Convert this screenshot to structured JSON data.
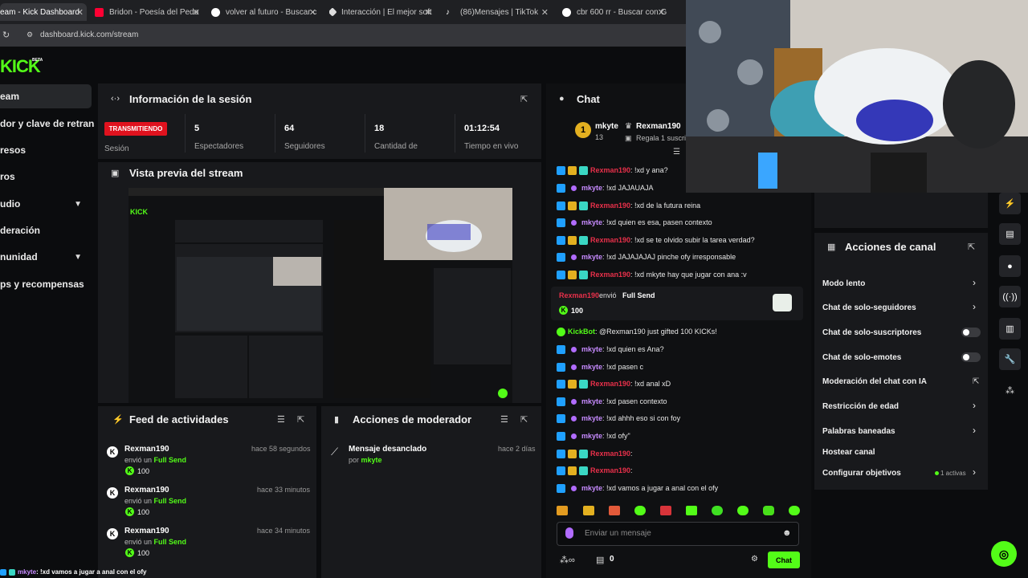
{
  "browser": {
    "tabs": [
      {
        "title": "eam - Kick Dashboard",
        "color": "#53fc18"
      },
      {
        "title": "Bridon - Poesía del Pedo",
        "color": "#ff0033"
      },
      {
        "title": "volver al futuro - Buscar c",
        "color": "#ffffff"
      },
      {
        "title": "Interacción | El mejor soft",
        "color": "#ffffff"
      },
      {
        "title": "(86)Mensajes | TikTok",
        "color": "#ffffff"
      },
      {
        "title": "cbr 600 rr - Buscar con G",
        "color": "#ffffff"
      }
    ],
    "url": "dashboard.kick.com/stream"
  },
  "brand": {
    "logo": "KICK",
    "beta": "BETA",
    "accent": "#53fc18"
  },
  "sidebar": {
    "items": [
      {
        "label": "eam",
        "active": true
      },
      {
        "label": "dor y clave de retransn"
      },
      {
        "label": "resos"
      },
      {
        "label": "ros"
      },
      {
        "label": "udio",
        "chevron": "⌄"
      },
      {
        "label": "deración"
      },
      {
        "label": "nunidad",
        "chevron": "⌄"
      },
      {
        "label": "ps y recompensas"
      }
    ]
  },
  "session": {
    "title": "Información de la sesión",
    "badge": "TRANSMITIENDO",
    "session_label": "Sesión",
    "stats": [
      {
        "value": "5",
        "label": "Espectadores"
      },
      {
        "value": "64",
        "label": "Seguidores"
      },
      {
        "value": "18",
        "label": "Cantidad de"
      },
      {
        "value": "01:12:54",
        "label": "Tiempo en vivo"
      }
    ]
  },
  "preview": {
    "title": "Vista previa del stream"
  },
  "feed": {
    "title": "Feed de actividades",
    "items": [
      {
        "name": "Rexman190",
        "sub": "envió un",
        "gift": "Full Send",
        "amount": "100",
        "time": "hace 58 segundos"
      },
      {
        "name": "Rexman190",
        "sub": "envió un",
        "gift": "Full Send",
        "amount": "100",
        "time": "hace 33 minutos"
      },
      {
        "name": "Rexman190",
        "sub": "envió un",
        "gift": "Full Send",
        "amount": "100",
        "time": "hace 34 minutos"
      }
    ]
  },
  "mod": {
    "title": "Acciones de moderador",
    "items": [
      {
        "action": "Mensaje desanclado",
        "by_label": "por",
        "by": "mkyte",
        "time": "hace 2 días"
      }
    ]
  },
  "chat": {
    "title": "Chat",
    "pinned": {
      "user": "mkyte",
      "count": "13",
      "gifter": "Rexman190",
      "text": "Regala 1 suscrip"
    },
    "messages": [
      {
        "user": "Rexman190",
        "color": "red",
        "badges": 3,
        "text": ": !xd y ana?"
      },
      {
        "user": "mkyte",
        "color": "purple",
        "badges": 1,
        "text": ": !xd JAJAUAJA"
      },
      {
        "user": "Rexman190",
        "color": "red",
        "badges": 3,
        "text": ": !xd de la futura reina"
      },
      {
        "user": "mkyte",
        "color": "purple",
        "badges": 1,
        "text": ": !xd quien es esa, pasen contexto"
      },
      {
        "user": "Rexman190",
        "color": "red",
        "badges": 3,
        "text": ": !xd se te olvido subir la tarea verdad?"
      },
      {
        "user": "mkyte",
        "color": "purple",
        "badges": 1,
        "text": ": !xd JAJAJAJAJ pinche ofy irresponsable"
      },
      {
        "user": "Rexman190",
        "color": "red",
        "badges": 3,
        "text": ": !xd mkyte hay que jugar con ana :v"
      }
    ],
    "gift": {
      "user": "Rexman190",
      "action": "envió",
      "item": "Full Send",
      "amount": "100"
    },
    "messages2": [
      {
        "user": "KickBot",
        "color": "green",
        "badges": 0,
        "text": ": @Rexman190 just gifted 100 KICKs!"
      },
      {
        "user": "mkyte",
        "color": "purple",
        "badges": 1,
        "text": ": !xd quien es Ana?"
      },
      {
        "user": "mkyte",
        "color": "purple",
        "badges": 1,
        "text": ": !xd pasen c"
      },
      {
        "user": "Rexman190",
        "color": "red",
        "badges": 3,
        "text": ": !xd anal xD"
      },
      {
        "user": "mkyte",
        "color": "purple",
        "badges": 1,
        "text": ": !xd pasen contexto"
      },
      {
        "user": "mkyte",
        "color": "purple",
        "badges": 1,
        "text": ": !xd ahhh eso si con foy"
      },
      {
        "user": "mkyte",
        "color": "purple",
        "badges": 1,
        "text": ": !xd ofy\""
      },
      {
        "user": "Rexman190",
        "color": "red",
        "badges": 3,
        "text": ":"
      },
      {
        "user": "Rexman190",
        "color": "red",
        "badges": 3,
        "text": ":"
      },
      {
        "user": "mkyte",
        "color": "purple",
        "badges": 1,
        "text": ": !xd vamos a jugar a anal con el ofy"
      }
    ],
    "input_placeholder": "Enviar un mensaje",
    "points": "0",
    "send": "Chat"
  },
  "channel": {
    "title": "Acciones de canal",
    "items": [
      {
        "label": "Modo lento",
        "type": "chevron"
      },
      {
        "label": "Chat de solo-seguidores",
        "type": "chevron"
      },
      {
        "label": "Chat de solo-suscriptores",
        "type": "toggle"
      },
      {
        "label": "Chat de solo-emotes",
        "type": "toggle"
      },
      {
        "label": "Moderación del chat con IA",
        "type": "external"
      },
      {
        "label": "Restricción de edad",
        "type": "chevron"
      },
      {
        "label": "Palabras baneadas",
        "type": "chevron"
      },
      {
        "label": "Hostear canal",
        "type": "none"
      },
      {
        "label": "Configurar objetivos",
        "type": "chevron",
        "extra": "1 activas"
      }
    ]
  },
  "ticker": {
    "user": "mkyte",
    "text": ": !xd vamos a jugar a anal con el ofy"
  }
}
